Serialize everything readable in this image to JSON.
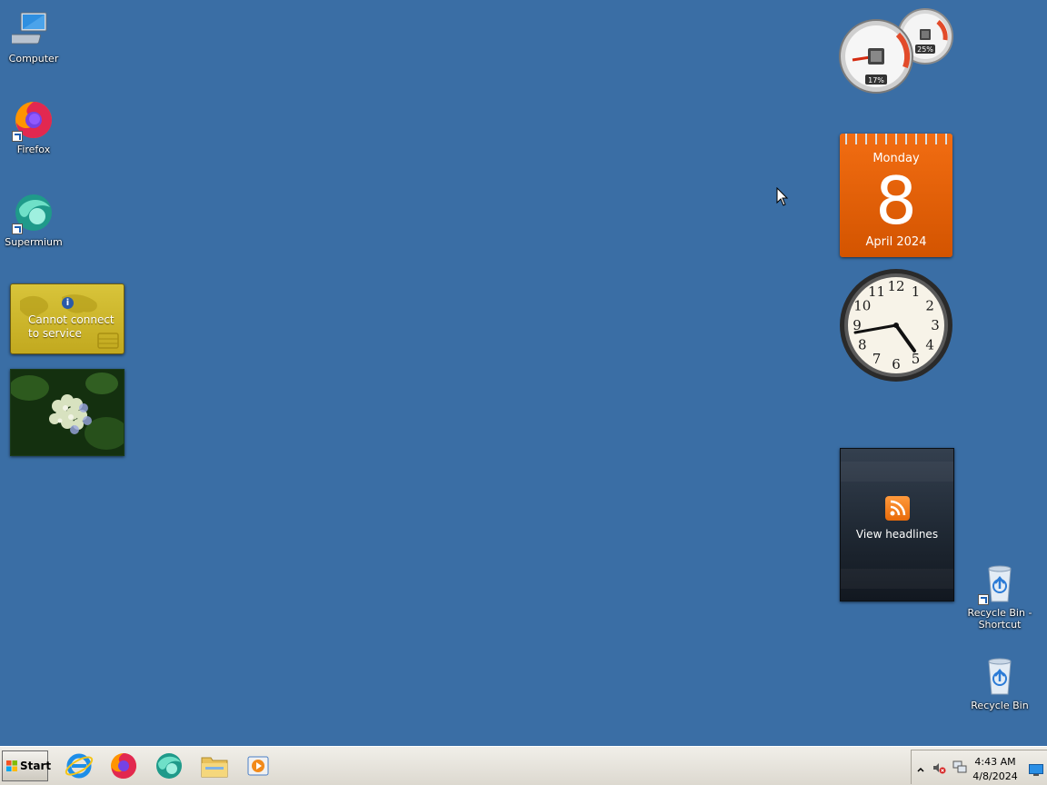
{
  "desktop": {
    "background_color": "#3a6ea5",
    "icons": [
      {
        "label": "Computer",
        "icon": "computer-icon"
      },
      {
        "label": "Firefox",
        "icon": "firefox-icon"
      },
      {
        "label": "Supermium",
        "icon": "supermium-icon"
      },
      {
        "label": "Recycle Bin - Shortcut",
        "icon": "recycle-bin-icon"
      },
      {
        "label": "Recycle Bin",
        "icon": "recycle-bin-icon"
      }
    ]
  },
  "gadgets": {
    "weather": {
      "line1": "Cannot connect",
      "line2": "to service",
      "icon": "info-icon"
    },
    "slideshow": {
      "icon": "hydrangea-photo"
    },
    "cpu_meter": {
      "cpu": "17%",
      "memory": "25%"
    },
    "calendar": {
      "day_of_week": "Monday",
      "day": "8",
      "month_year": "April 2024",
      "accent": "#e8620a"
    },
    "clock": {
      "numbers": [
        "12",
        "1",
        "2",
        "3",
        "4",
        "5",
        "6",
        "7",
        "8",
        "9",
        "10",
        "11"
      ],
      "time": "4:43"
    },
    "headlines": {
      "label": "View headlines",
      "icon": "rss-icon"
    }
  },
  "taskbar": {
    "start_label": "Start",
    "pinned": [
      "internet-explorer-icon",
      "firefox-icon",
      "supermium-icon",
      "file-explorer-icon",
      "media-player-icon"
    ],
    "tray": {
      "icons": [
        "show-hidden-icons-icon",
        "volume-muted-icon",
        "network-icon"
      ],
      "time": "4:43 AM",
      "date": "4/8/2024"
    }
  }
}
